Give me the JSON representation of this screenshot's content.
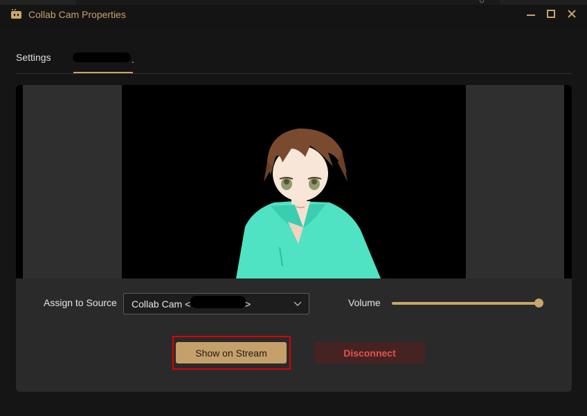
{
  "window": {
    "title": "Collab Cam Properties",
    "app_icon": "collab-cam-icon",
    "controls": [
      "minimize-icon",
      "maximize-icon",
      "close-icon"
    ]
  },
  "tabs": [
    {
      "label": "Settings",
      "active": false
    },
    {
      "label": ".",
      "active": true,
      "redacted": true
    }
  ],
  "preview": {
    "description_icon": "avatar-preview"
  },
  "assign": {
    "label": "Assign to Source",
    "selected_prefix": "Collab Cam <",
    "selected_suffix": ">",
    "redacted": true
  },
  "volume": {
    "label": "Volume",
    "level": 1.0
  },
  "actions": {
    "show_label": "Show on Stream",
    "disconnect_label": "Disconnect"
  },
  "colors": {
    "accent": "#c9a56b",
    "background": "#151515",
    "panel": "#2a2a2a",
    "danger_text": "#e7504b",
    "danger_bg": "#462323",
    "highlight": "#e00000"
  }
}
